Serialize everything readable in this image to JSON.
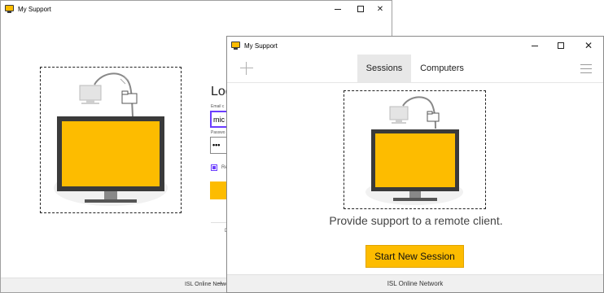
{
  "back_window": {
    "title": "My Support",
    "login_title": "Log",
    "email_label": "Email c",
    "email_value": "mic",
    "password_label": "Passwo",
    "password_value": "•••",
    "remember_label": "Re",
    "bottom_text": "D",
    "footer_text": "ISL Online Network",
    "footer_plus": "+"
  },
  "front_window": {
    "title": "My Support",
    "tabs": [
      {
        "label": "Sessions",
        "active": true
      },
      {
        "label": "Computers",
        "active": false
      }
    ],
    "provide_text": "Provide support to a remote client.",
    "start_button": "Start New Session",
    "footer_text": "ISL Online Network"
  },
  "colors": {
    "accent": "#fdbc00",
    "monitor_frame": "#3a3a3a",
    "checkbox": "#6b3dff"
  },
  "icons": [
    "app-icon",
    "minimize-icon",
    "maximize-icon",
    "close-icon",
    "plus-icon",
    "hamburger-menu-icon",
    "computer-icon",
    "folder-icon"
  ]
}
